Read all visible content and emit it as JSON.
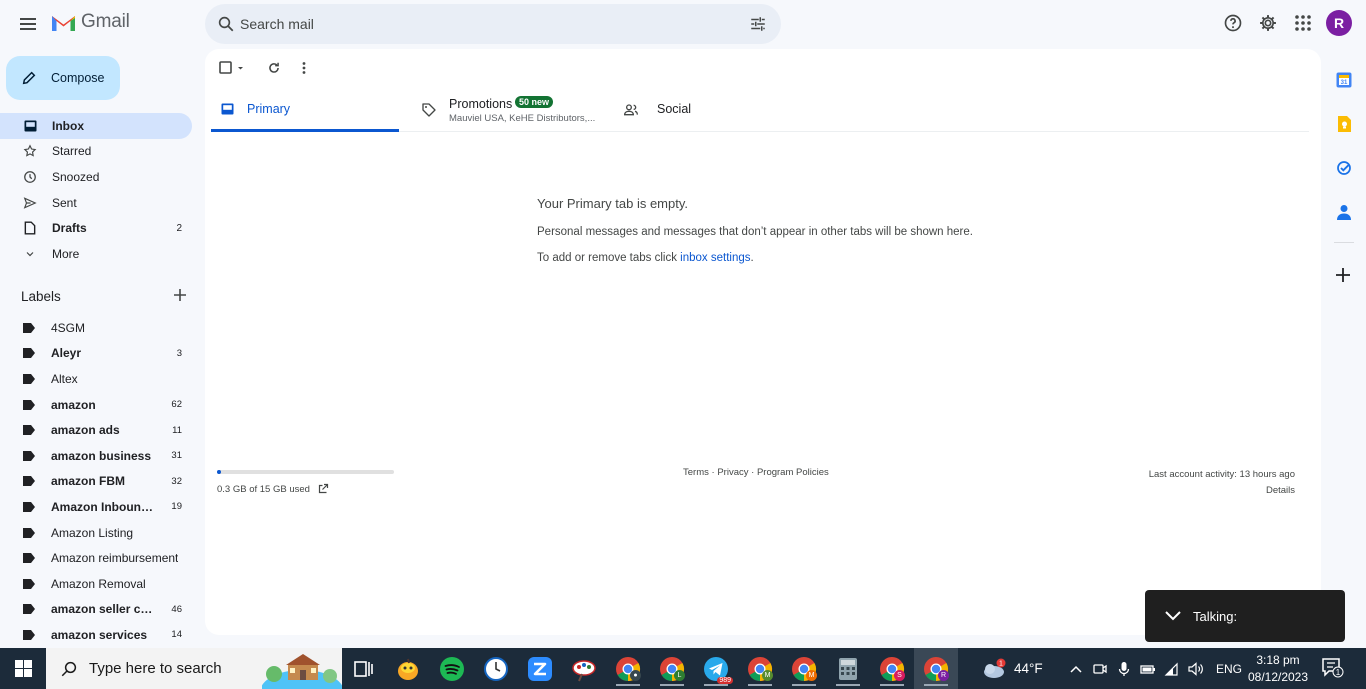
{
  "app": {
    "name": "Gmail"
  },
  "header": {
    "search_placeholder": "Search mail",
    "avatar_letter": "R",
    "avatar_color": "#7b1fa2"
  },
  "compose_label": "Compose",
  "nav": {
    "items": [
      {
        "label": "Inbox",
        "count": "",
        "icon": "inbox-icon",
        "active": true
      },
      {
        "label": "Starred",
        "count": "",
        "icon": "star-icon"
      },
      {
        "label": "Snoozed",
        "count": "",
        "icon": "clock-icon"
      },
      {
        "label": "Sent",
        "count": "",
        "icon": "send-icon"
      },
      {
        "label": "Drafts",
        "count": "2",
        "icon": "draft-icon"
      },
      {
        "label": "More",
        "count": "",
        "icon": "chevron-down-icon"
      }
    ]
  },
  "labels": {
    "title": "Labels",
    "items": [
      {
        "label": "4SGM",
        "count": "",
        "bold": false
      },
      {
        "label": "Aleyr",
        "count": "3",
        "bold": true
      },
      {
        "label": "Altex",
        "count": "",
        "bold": false
      },
      {
        "label": "amazon",
        "count": "62",
        "bold": true
      },
      {
        "label": "amazon ads",
        "count": "11",
        "bold": true
      },
      {
        "label": "amazon business",
        "count": "31",
        "bold": true
      },
      {
        "label": "amazon FBM",
        "count": "32",
        "bold": true
      },
      {
        "label": "Amazon Inbound ...",
        "count": "19",
        "bold": true
      },
      {
        "label": "Amazon Listing",
        "count": "",
        "bold": false
      },
      {
        "label": "Amazon reimbursement",
        "count": "",
        "bold": false
      },
      {
        "label": "Amazon Removal",
        "count": "",
        "bold": false
      },
      {
        "label": "amazon seller cen...",
        "count": "46",
        "bold": true
      },
      {
        "label": "amazon services",
        "count": "14",
        "bold": true
      }
    ]
  },
  "tabs": {
    "primary": {
      "label": "Primary"
    },
    "promotions": {
      "label": "Promotions",
      "badge": "50 new",
      "subtitle": "Mauviel USA, KeHE Distributors,..."
    },
    "social": {
      "label": "Social"
    }
  },
  "empty_state": {
    "title": "Your Primary tab is empty.",
    "line1": "Personal messages and messages that don’t appear in other tabs will be shown here.",
    "line2_prefix": "To add or remove tabs click ",
    "line2_link": "inbox settings",
    "line2_suffix": "."
  },
  "footer": {
    "storage_text": "0.3 GB of 15 GB used",
    "storage_fraction": 0.02,
    "links": [
      "Terms",
      "Privacy",
      "Program Policies"
    ],
    "activity": "Last account activity: 13 hours ago",
    "details": "Details"
  },
  "talking_popup": {
    "label": "Talking:"
  },
  "taskbar": {
    "search_placeholder": "Type here to search",
    "apps": [
      "task-view",
      "fruit-app",
      "spotify",
      "clock-app",
      "zoom",
      "paint-app",
      "chrome",
      "chrome-l",
      "telegram",
      "chrome-m",
      "chrome-m2",
      "calculator",
      "chrome-s",
      "chrome-r"
    ],
    "telegram_badge": "989",
    "weather": {
      "temp": "44°F",
      "alert": "1"
    },
    "language": "ENG",
    "time": "3:18 pm",
    "date": "08/12/2023",
    "notification_count": "1"
  }
}
